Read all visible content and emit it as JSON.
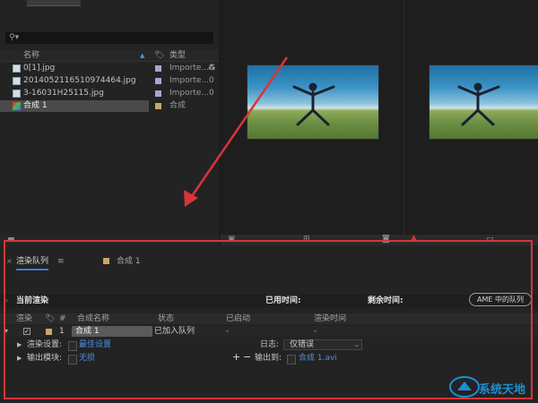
{
  "project_panel": {
    "search": {
      "placeholder": ""
    },
    "headers": {
      "name": "名称",
      "type": "类型"
    },
    "items": [
      {
        "name": "0[1].jpg",
        "type": "Importe...G",
        "kind": "image",
        "label_color": "#a6a6d6"
      },
      {
        "name": "2014052116510974464.jpg",
        "type": "Importe...0",
        "kind": "image",
        "label_color": "#a6a6d6"
      },
      {
        "name": "3-16031H25115.jpg",
        "type": "Importe...0",
        "kind": "image",
        "label_color": "#a6a6d6"
      },
      {
        "name": "合成 1",
        "type": "合成",
        "kind": "composition",
        "label_color": "#c8a868",
        "selected": true
      }
    ]
  },
  "render_queue": {
    "tab_label": "渲染队列",
    "comp_tab_label": "合成 1",
    "status": {
      "current_render": "当前渲染",
      "elapsed": "已用时间:",
      "remaining": "剩余时间:",
      "ame_button": "AME 中的队列"
    },
    "columns": {
      "render": "渲染",
      "label": "",
      "number": "#",
      "comp_name": "合成名称",
      "status": "状态",
      "started": "已启动",
      "render_time": "渲染时间"
    },
    "row": {
      "number": "1",
      "comp_name": "合成 1",
      "status": "已加入队列",
      "started": "-",
      "render_time": "-",
      "checked": true
    },
    "render_settings": {
      "label": "渲染设置:",
      "value": "最佳设置"
    },
    "log": {
      "label": "日志:",
      "value": "仅错误"
    },
    "output_module": {
      "label": "输出模块:",
      "value": "无损"
    },
    "output_to": {
      "label": "输出到:",
      "value": "合成 1.avi"
    }
  },
  "watermark": {
    "text": "系统天地"
  },
  "colors": {
    "accent": "#3d7fd6",
    "highlight_red": "#d9343a",
    "link_blue": "#4a8fe8"
  }
}
